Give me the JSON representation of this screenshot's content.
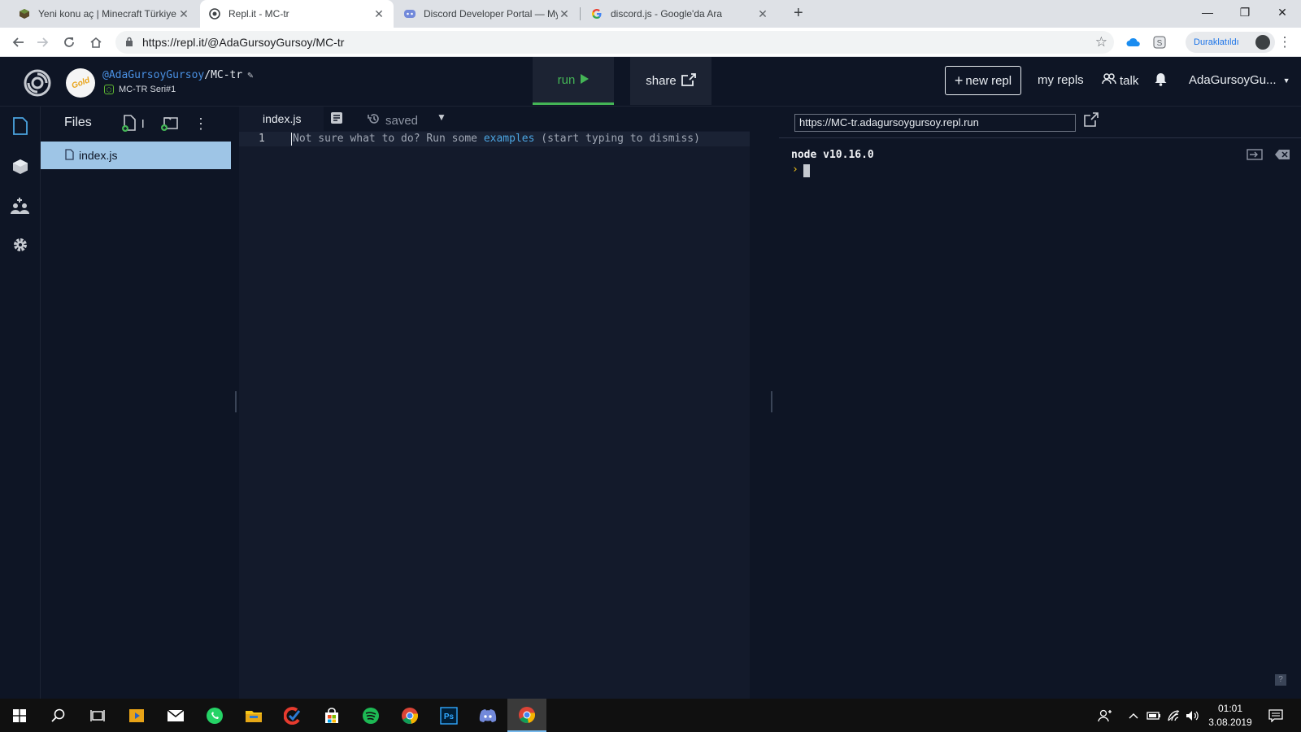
{
  "browser": {
    "tabs": [
      {
        "title": "Yeni konu aç | Minecraft Türkiye",
        "icon": "minecraft-block-icon"
      },
      {
        "title": "Repl.it - MC-tr",
        "icon": "replit-icon"
      },
      {
        "title": "Discord Developer Portal — My Applications",
        "icon": "discord-icon"
      },
      {
        "title": "discord.js - Google'da Ara",
        "icon": "google-icon"
      }
    ],
    "url": "https://repl.it/@AdaGursoyGursoy/MC-tr",
    "profile_label": "Duraklatıldı"
  },
  "replit": {
    "user": "@AdaGursoyGursoy",
    "repl_name": "MC-tr",
    "repl_desc": "MC-TR Seri#1",
    "avatar_text": "Gold",
    "run_label": "run",
    "share_label": "share",
    "new_repl_label": "new repl",
    "my_repls_label": "my repls",
    "talk_label": "talk",
    "account_label": "AdaGursoyGu..."
  },
  "files": {
    "title": "Files",
    "items": [
      {
        "name": "index.js"
      }
    ]
  },
  "editor": {
    "tab": "index.js",
    "status": "saved",
    "line_number": "1",
    "hint_pre": "Not sure what to do? Run some ",
    "hint_link": "examples",
    "hint_post": " (start typing to dismiss)"
  },
  "console": {
    "web_url": "https://MC-tr.adagursoygursoy.repl.run",
    "output": "node v10.16.0",
    "help_label": "?"
  },
  "taskbar": {
    "time": "01:01",
    "date": "3.08.2019"
  },
  "colors": {
    "run_green": "#44b556",
    "bg": "#0e1525",
    "editor_bg": "#131a2b",
    "selected_file": "#9ec5e6",
    "link_blue": "#4ba4e0"
  }
}
